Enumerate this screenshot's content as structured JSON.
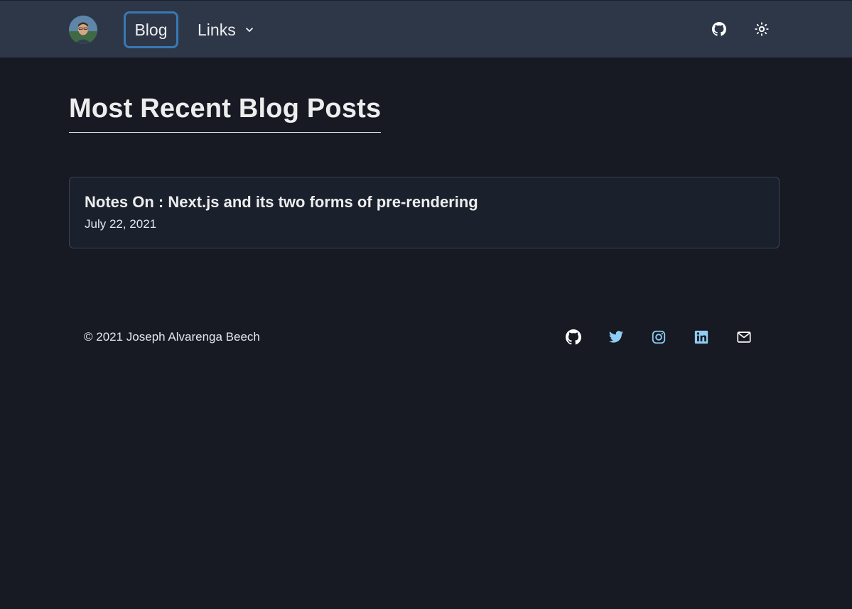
{
  "navbar": {
    "blog_label": "Blog",
    "links_label": "Links",
    "icons": {
      "github": "github-icon",
      "theme": "sun-icon"
    }
  },
  "main": {
    "title": "Most Recent Blog Posts",
    "posts": [
      {
        "title": "Notes On : Next.js and its two forms of pre-rendering",
        "date": "July 22, 2021"
      }
    ]
  },
  "footer": {
    "copyright": "© 2021 Joseph Alvarenga Beech",
    "icons": [
      "github-icon",
      "twitter-icon",
      "instagram-icon",
      "linkedin-icon",
      "mail-icon"
    ],
    "icon_colors": {
      "github": "#ffffff",
      "social": "#90cdf4"
    }
  },
  "colors": {
    "background": "#171923",
    "navbar": "#2d3748",
    "card": "#1a202c",
    "active_border": "#3a78b5"
  }
}
